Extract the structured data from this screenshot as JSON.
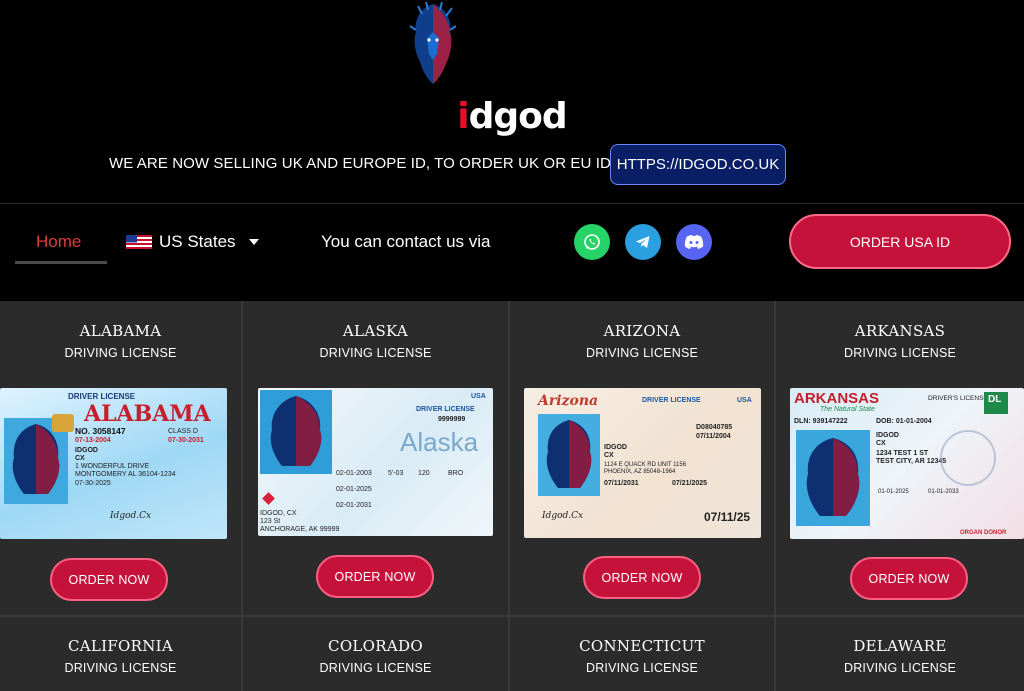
{
  "brand": {
    "prefix": "i",
    "rest": "dgod"
  },
  "notice": "WE ARE NOW SELLING UK AND EUROPE ID, TO ORDER UK OR EU ID VISIT",
  "uk_link": "HTTPS://IDGOD.CO.UK",
  "nav": {
    "home": "Home",
    "states": "US States",
    "contact": "You can contact us via",
    "order_usa": "ORDER USA ID"
  },
  "icons": {
    "logo": "lion-head-logo-icon",
    "flag": "us-flag-icon",
    "caret": "chevron-down-icon",
    "whatsapp": "whatsapp-icon",
    "telegram": "telegram-icon",
    "discord": "discord-icon"
  },
  "colors": {
    "accent": "#c4123a",
    "link_blue": "#0a1e66",
    "whatsapp": "#25d366",
    "telegram": "#2aa0e0",
    "discord": "#5865f2"
  },
  "states": [
    {
      "name": "ALABAMA",
      "sub": "DRIVING LICENSE",
      "order": "ORDER NOW",
      "card": {
        "header": "DRIVER LICENSE",
        "title": "ALABAMA",
        "no": "NO. 3058147",
        "class": "CLASS D",
        "dob": "07-13-2004",
        "exp": "07-30-2031",
        "name1": "IDGOD",
        "name2": "CX",
        "addr1": "1 WONDERFUL DRIVE",
        "addr2": "MONTGOMERY AL 36104-1234",
        "iss": "07-30-2025",
        "sig": "Idgod.Cx"
      }
    },
    {
      "name": "ALASKA",
      "sub": "DRIVING LICENSE",
      "order": "ORDER NOW",
      "card": {
        "header": "DRIVER LICENSE",
        "usa": "USA",
        "no": "9999999",
        "title": "Alaska",
        "dob": "02-01-2003",
        "exp": "02-01-2031",
        "iss": "02-01-2025",
        "name1": "IDGOD, CX",
        "addr1": "123 St",
        "addr2": "ANCHORAGE, AK 99999",
        "hgt": "5'-03",
        "wgt": "120",
        "eyes": "BRO"
      }
    },
    {
      "name": "ARIZONA",
      "sub": "DRIVING LICENSE",
      "order": "ORDER NOW",
      "card": {
        "title": "Arizona",
        "header": "DRIVER LICENSE",
        "usa": "USA",
        "dln": "D08040785",
        "dob": "07/11/2004",
        "name1": "IDGOD",
        "name2": "CX",
        "addr1": "1124 E QUACK RD UNIT 1156",
        "addr2": "PHOENIX, AZ 85048-1964",
        "exp": "07/11/2031",
        "iss": "07/21/2025",
        "bottom": "07/11/25",
        "sig": "Idgod.Cx"
      }
    },
    {
      "name": "ARKANSAS",
      "sub": "DRIVING LICENSE",
      "order": "ORDER NOW",
      "card": {
        "title": "ARKANSAS",
        "header": "DRIVER'S LICENSE",
        "badge": "DL",
        "tag": "The Natural State",
        "dln": "DLN: 939147222",
        "dob": "DOB: 01-01-2004",
        "name1": "IDGOD",
        "name2": "CX",
        "addr1": "1234 TEST 1 ST",
        "addr2": "TEST CITY, AR 12345",
        "iss": "01-01-2025",
        "exp": "01-01-2033",
        "donor": "ORGAN DONOR"
      }
    },
    {
      "name": "CALIFORNIA",
      "sub": "DRIVING LICENSE"
    },
    {
      "name": "COLORADO",
      "sub": "DRIVING LICENSE"
    },
    {
      "name": "CONNECTICUT",
      "sub": "DRIVING LICENSE"
    },
    {
      "name": "DELAWARE",
      "sub": "DRIVING LICENSE"
    }
  ]
}
